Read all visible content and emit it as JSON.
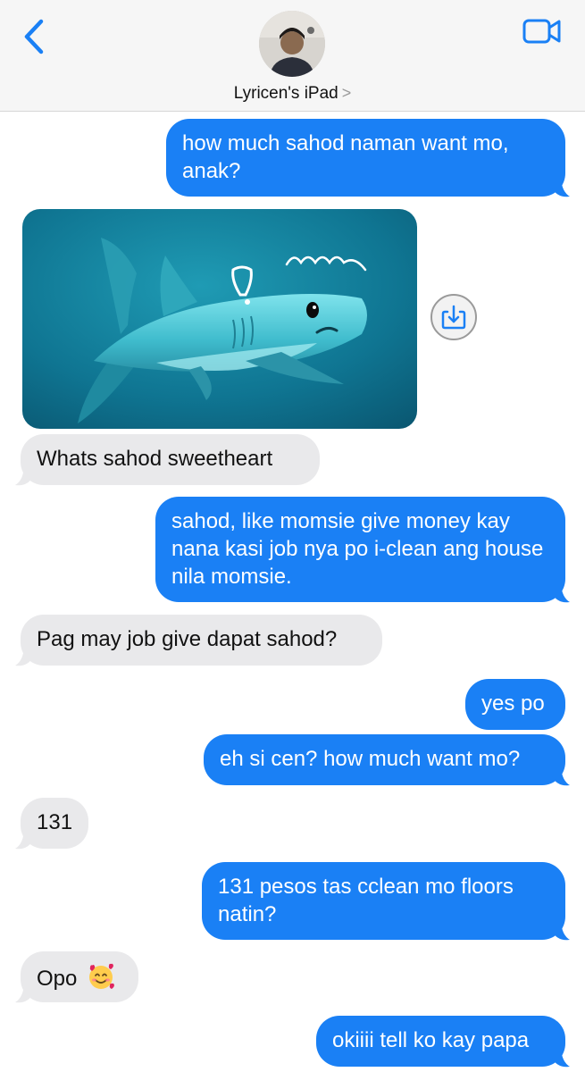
{
  "header": {
    "contact_name": "Lyricen's iPad",
    "chevron": ">",
    "back_icon": "chevron-left-icon",
    "video_icon": "video-camera-icon"
  },
  "colors": {
    "outgoing_bubble": "#1a80f5",
    "incoming_bubble": "#e9e9eb",
    "accent": "#1a80f5"
  },
  "messages": [
    {
      "direction": "outgoing",
      "type": "text",
      "text": "how much sahod naman want mo, anak?"
    },
    {
      "direction": "incoming",
      "type": "image",
      "description": "shark-sticker-image",
      "action_icon": "save-to-device-icon"
    },
    {
      "direction": "incoming",
      "type": "text",
      "text": "Whats sahod sweetheart"
    },
    {
      "direction": "outgoing",
      "type": "text",
      "text": "sahod, like momsie give money kay nana kasi job nya po i-clean ang house nila momsie."
    },
    {
      "direction": "incoming",
      "type": "text",
      "text": "Pag may job give dapat sahod?"
    },
    {
      "direction": "outgoing",
      "type": "text",
      "text": "yes po"
    },
    {
      "direction": "outgoing",
      "type": "text",
      "text": "eh si cen? how much want mo?"
    },
    {
      "direction": "incoming",
      "type": "text",
      "text": "131"
    },
    {
      "direction": "outgoing",
      "type": "text",
      "text": "131 pesos tas cclean mo floors natin?"
    },
    {
      "direction": "incoming",
      "type": "text",
      "text": "Opo",
      "emoji": "smiling-face-with-hearts-emoji"
    },
    {
      "direction": "outgoing",
      "type": "text",
      "text": "okiiii tell ko kay papa"
    }
  ]
}
